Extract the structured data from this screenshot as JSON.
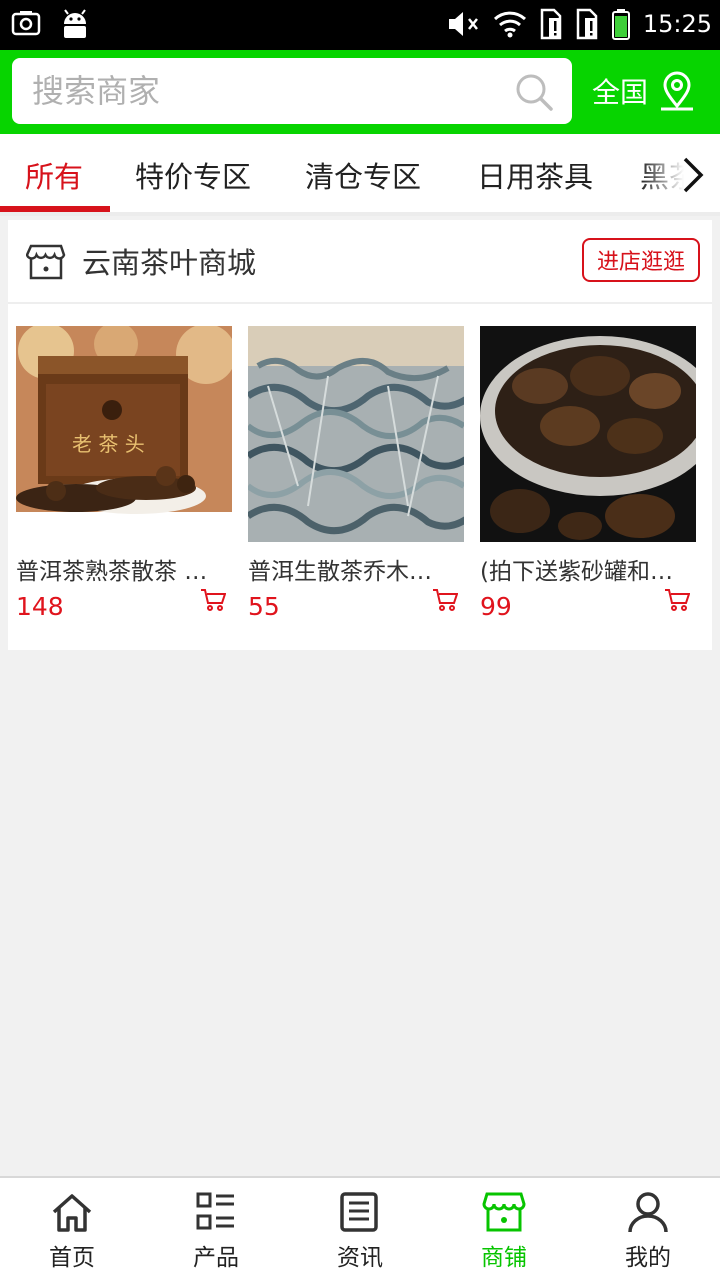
{
  "status_bar": {
    "time": "15:25",
    "icons": [
      "screenshot-icon",
      "android-icon",
      "mute-icon",
      "wifi-icon",
      "sim-alert-icon",
      "sim-alert-icon",
      "battery-icon"
    ]
  },
  "header": {
    "search_placeholder": "搜索商家",
    "region_label": "全国",
    "bg_color": "#07d400"
  },
  "tabs": [
    {
      "label": "所有",
      "active": true
    },
    {
      "label": "特价专区",
      "active": false
    },
    {
      "label": "清仓专区",
      "active": false
    },
    {
      "label": "日用茶具",
      "active": false
    },
    {
      "label": "黑茶",
      "active": false
    }
  ],
  "store": {
    "name": "云南茶叶商城",
    "visit_label": "进店逛逛",
    "products": [
      {
        "name": "普洱茶熟茶散茶 …",
        "price": "148"
      },
      {
        "name": "普洱生散茶乔木…",
        "price": "55"
      },
      {
        "name": "(拍下送紫砂罐和…",
        "price": "99"
      }
    ]
  },
  "bottom_nav": [
    {
      "label": "首页",
      "icon": "home-icon",
      "active": false
    },
    {
      "label": "产品",
      "icon": "product-list-icon",
      "active": false
    },
    {
      "label": "资讯",
      "icon": "news-icon",
      "active": false
    },
    {
      "label": "商铺",
      "icon": "shop-icon",
      "active": true
    },
    {
      "label": "我的",
      "icon": "user-icon",
      "active": false
    }
  ],
  "colors": {
    "accent_red": "#d7121b",
    "brand_green": "#07d400",
    "price_red": "#e0141d"
  }
}
